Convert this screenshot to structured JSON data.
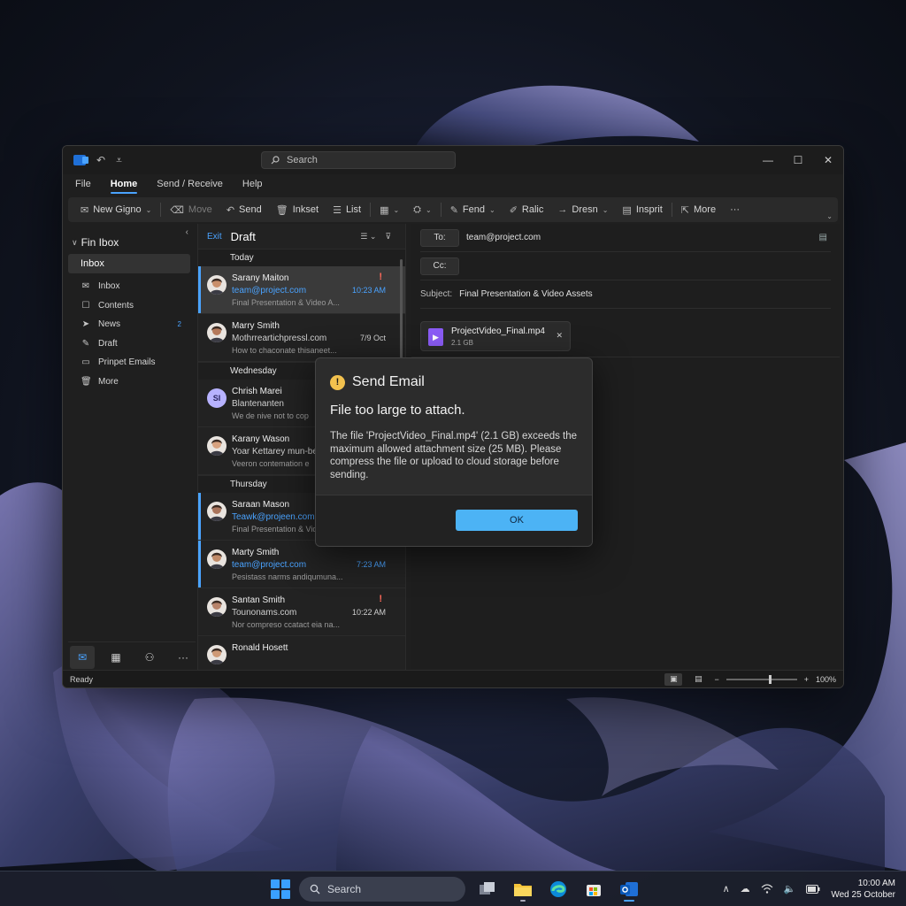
{
  "titlebar": {
    "search_placeholder": "Search",
    "undo_glyph": "↶",
    "customize_glyph": "⩡"
  },
  "window_controls": {
    "minimize": "—",
    "maximize": "☐",
    "close": "✕"
  },
  "menu": [
    "File",
    "Home",
    "Send / Receive",
    "Help"
  ],
  "ribbon": [
    {
      "label": "New Gigno",
      "icon": "mail-icon",
      "glyph": "✉",
      "caret": true,
      "disabled": false
    },
    {
      "label": "Move",
      "icon": "move-icon",
      "glyph": "⌫",
      "caret": false,
      "disabled": true
    },
    {
      "label": "Send",
      "icon": "reply-icon",
      "glyph": "↶",
      "caret": false,
      "disabled": false
    },
    {
      "label": "Inkset",
      "icon": "trash-icon",
      "glyph": "🗑",
      "caret": false,
      "disabled": false
    },
    {
      "label": "List",
      "icon": "list-icon",
      "glyph": "☰",
      "caret": false,
      "disabled": false
    },
    {
      "label": "",
      "icon": "template-icon",
      "glyph": "▦",
      "caret": true,
      "disabled": false
    },
    {
      "label": "",
      "icon": "share-icon",
      "glyph": "⛭",
      "caret": true,
      "disabled": false
    },
    {
      "label": "Fend",
      "icon": "edit-icon",
      "glyph": "✎",
      "caret": true,
      "disabled": false
    },
    {
      "label": "Ralic",
      "icon": "pen-icon",
      "glyph": "✐",
      "caret": false,
      "disabled": false
    },
    {
      "label": "Dresn",
      "icon": "forward-icon",
      "glyph": "→",
      "caret": true,
      "disabled": false
    },
    {
      "label": "Insprit",
      "icon": "notes-icon",
      "glyph": "▤",
      "caret": false,
      "disabled": false
    },
    {
      "label": "More",
      "icon": "share-out-icon",
      "glyph": "⇱",
      "caret": false,
      "disabled": false
    },
    {
      "label": "···",
      "icon": "overflow-icon",
      "glyph": "",
      "caret": false,
      "disabled": false
    }
  ],
  "folders": {
    "header": "Fin Ibox",
    "selected": "Inbox",
    "items": [
      {
        "label": "Inbox",
        "icon": "inbox-icon",
        "glyph": "✉",
        "count": ""
      },
      {
        "label": "Contents",
        "icon": "drafts-icon",
        "glyph": "☐",
        "count": ""
      },
      {
        "label": "News",
        "icon": "send-icon",
        "glyph": "➤",
        "count": "2"
      },
      {
        "label": "Draft",
        "icon": "draft-icon",
        "glyph": "✎",
        "count": ""
      },
      {
        "label": "Prinpet Emails",
        "icon": "folder-icon",
        "glyph": "▭",
        "count": ""
      },
      {
        "label": "More",
        "icon": "trash-icon",
        "glyph": "🗑",
        "count": ""
      }
    ]
  },
  "message_list": {
    "tab1": "Exit",
    "tab2": "Draft",
    "groups": [
      {
        "label": "Today",
        "messages": [
          {
            "sender": "Sarany Maiton",
            "email": "team@project.com",
            "preview": "Final Presentation & Video A...",
            "time": "10:23 AM",
            "avatar": "photo",
            "selected": true,
            "flagbar": true,
            "important": true,
            "blue": true
          },
          {
            "sender": "Marry Smith",
            "email": "Mothrreartichpressl.com",
            "preview": "How to chaconate thisaneet...",
            "time": "7/9 Oct",
            "avatar": "photo",
            "selected": false,
            "flagbar": false,
            "important": false,
            "blue": false
          }
        ]
      },
      {
        "label": "Wednesday",
        "messages": [
          {
            "sender": "Chrish Marei",
            "email": "Blantenanten",
            "preview": "We de nive not to cop",
            "time": "",
            "avatar": "SI",
            "selected": false,
            "flagbar": false,
            "important": false,
            "blue": false
          },
          {
            "sender": "Karany Wason",
            "email": "Yoar Kettarey mun-bek",
            "preview": "Veeron contemation e",
            "time": "",
            "avatar": "photo",
            "selected": false,
            "flagbar": false,
            "important": false,
            "blue": false
          }
        ]
      },
      {
        "label": "Thursday",
        "messages": [
          {
            "sender": "Saraan Mason",
            "email": "Teawk@projeen.com",
            "preview": "Final Presentation & Video A...",
            "time": "",
            "avatar": "photo",
            "selected": false,
            "flagbar": true,
            "important": false,
            "blue": true
          },
          {
            "sender": "Marty Smith",
            "email": "team@project.com",
            "preview": "Pesistass narms andiqumuna...",
            "time": "7:23 AM",
            "avatar": "photo",
            "selected": false,
            "flagbar": true,
            "important": false,
            "blue": true
          },
          {
            "sender": "Santan Smith",
            "email": "Tounonams.com",
            "preview": "Nor compreso ccatact eia na...",
            "time": "10:22 AM",
            "avatar": "photo",
            "selected": false,
            "flagbar": false,
            "important": true,
            "blue": false
          },
          {
            "sender": "Ronald Hosett",
            "email": "",
            "preview": "",
            "time": "",
            "avatar": "photo",
            "selected": false,
            "flagbar": false,
            "important": false,
            "blue": false
          }
        ]
      }
    ]
  },
  "compose": {
    "to_label": "To:",
    "to_value": "team@project.com",
    "cc_label": "Cc:",
    "cc_value": "",
    "subject_label": "Subject:",
    "subject_value": "Final Presentation & Video Assets",
    "attachment": {
      "name": "ProjectVideo_Final.mp4",
      "size": "2.1 GB"
    }
  },
  "dialog": {
    "title": "Send Email",
    "subtitle": "File too large to attach.",
    "body": "The file 'ProjectVideo_Final.mp4' (2.1 GB) exceeds the maximum allowed attachment size (25 MB). Please compress the file or upload to cloud storage before sending.",
    "ok": "OK"
  },
  "statusbar": {
    "status": "Ready",
    "zoom": "100%",
    "zoom_level": 0.6
  },
  "taskbar": {
    "search": "Search",
    "time": "10:00 AM",
    "date": "Wed 25 October"
  },
  "colors": {
    "accent": "#4aa3ff",
    "warning": "#f2c14e",
    "ok_button": "#4cb3f5",
    "important": "#ff6a5a"
  }
}
